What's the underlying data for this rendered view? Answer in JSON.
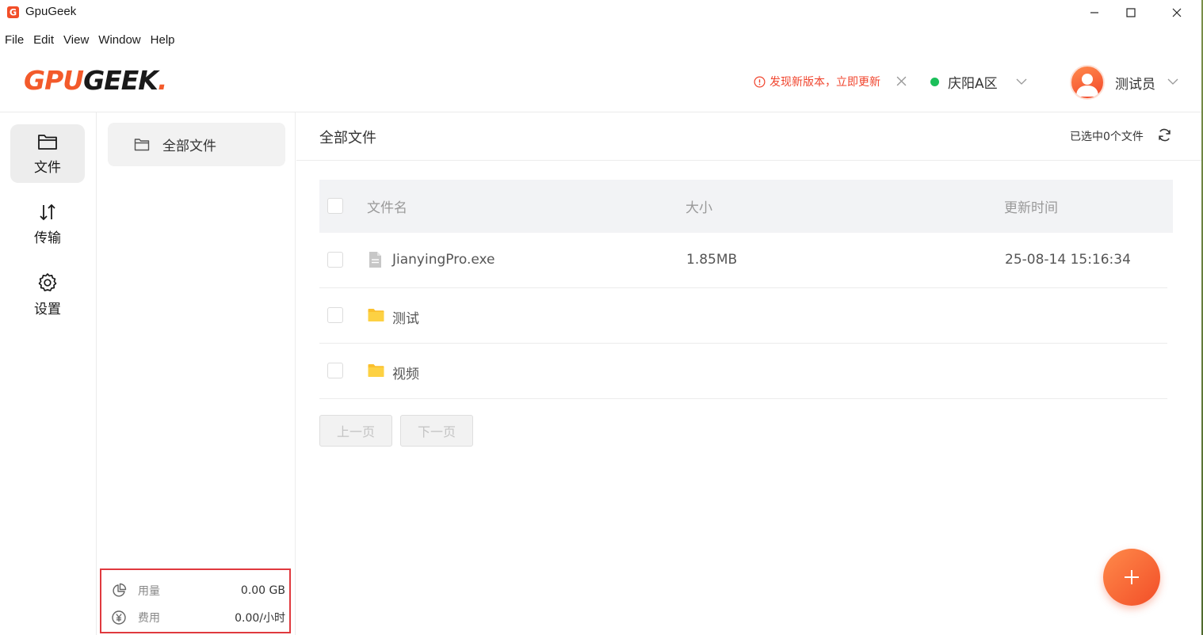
{
  "window": {
    "title": "GpuGeek",
    "icon": "gpugeek-app-icon"
  },
  "menu": [
    "File",
    "Edit",
    "View",
    "Window",
    "Help"
  ],
  "header": {
    "logo": {
      "part1": "GPU",
      "part2": "GEEK",
      "dot": "."
    },
    "update_notice": "发现新版本，立即更新",
    "region": {
      "label": "庆阳A区",
      "status_color": "#1bbf5a"
    },
    "user": {
      "name": "测试员"
    }
  },
  "nav": [
    {
      "label": "文件",
      "icon": "folder-icon",
      "active": true
    },
    {
      "label": "传输",
      "icon": "transfer-arrows-icon",
      "active": false
    },
    {
      "label": "设置",
      "icon": "gear-icon",
      "active": false
    }
  ],
  "folder_panel": {
    "all_files": "全部文件",
    "usage": {
      "label": "用量",
      "value": "0.00 GB"
    },
    "cost": {
      "label": "费用",
      "value": "0.00/小时"
    }
  },
  "main": {
    "title": "全部文件",
    "selected_count": "已选中0个文件",
    "columns": {
      "name": "文件名",
      "size": "大小",
      "updated": "更新时间"
    },
    "rows": [
      {
        "name": "JianyingPro.exe",
        "type": "file",
        "size": "1.85MB",
        "updated": "25-08-14 15:16:34"
      },
      {
        "name": "测试",
        "type": "folder",
        "size": "",
        "updated": ""
      },
      {
        "name": "视频",
        "type": "folder",
        "size": "",
        "updated": ""
      }
    ],
    "pager": {
      "prev": "上一页",
      "next": "下一页"
    }
  },
  "colors": {
    "accent": "#f35a2b",
    "highlight_box": "#e0393e",
    "folder": "#fbc02d"
  }
}
